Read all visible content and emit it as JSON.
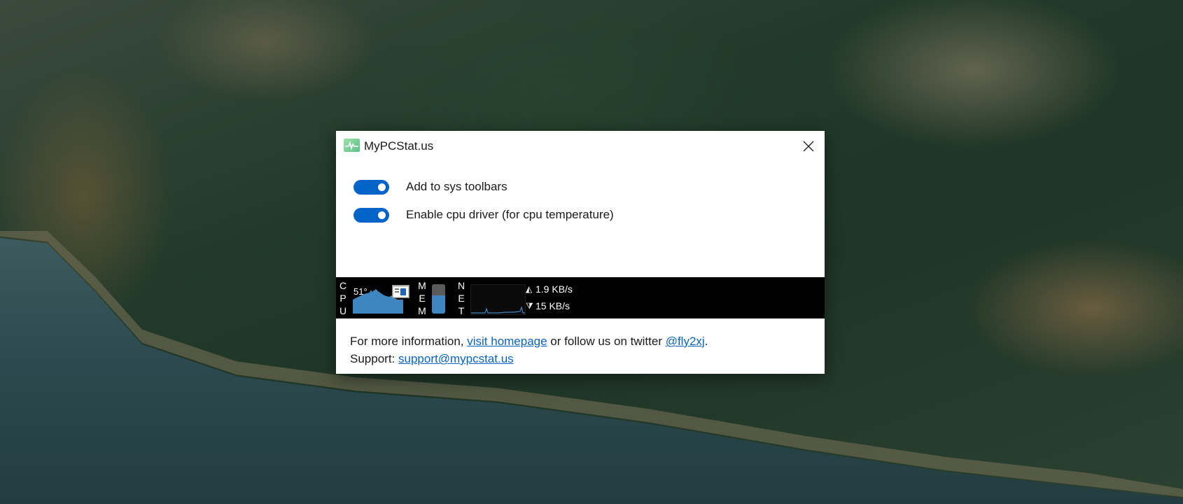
{
  "window": {
    "title": "MyPCStat.us",
    "icon": "pulse-chart-icon",
    "close_icon": "close-icon"
  },
  "options": [
    {
      "label": "Add to sys toolbars",
      "enabled": true
    },
    {
      "label": "Enable cpu driver (for cpu temperature)",
      "enabled": true
    }
  ],
  "stats": {
    "cpu_letters": [
      "C",
      "P",
      "U"
    ],
    "cpu_value": "51°",
    "mem_letters": [
      "M",
      "E",
      "M"
    ],
    "mem_level": 0.62,
    "net_letters": [
      "N",
      "E",
      "T"
    ],
    "upload": "1.9 KB/s",
    "download": "15 KB/s"
  },
  "footer": {
    "info_prefix": "For more information, ",
    "homepage_link": "visit homepage",
    "info_middle": " or follow us on twitter ",
    "twitter_link": "@fly2xj",
    "info_suffix": ".",
    "support_prefix": "Support: ",
    "support_link": "support@mypcstat.us"
  },
  "colors": {
    "toggle_on": "#0063c8",
    "link": "#0b63c1",
    "graph_fill": "#3f86c0",
    "stat_bar_bg": "#000000"
  }
}
